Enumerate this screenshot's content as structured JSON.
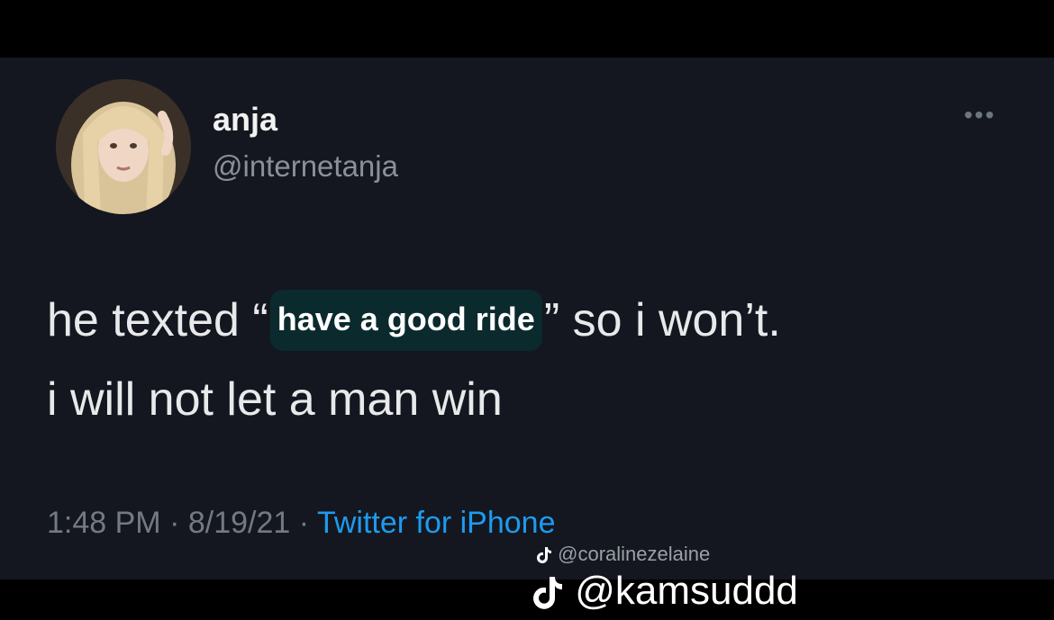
{
  "tweet": {
    "display_name": "anja",
    "handle": "@internetanja",
    "more_icon": "more-horizontal-icon",
    "text": {
      "prefix": "he texted",
      "open_quote": "“",
      "highlight": "have a good ride",
      "close_quote": "”",
      "suffix": "so i won’t.",
      "line2": "i will not let a man win"
    },
    "meta": {
      "time": "1:48 PM",
      "separator": "·",
      "date": "8/19/21",
      "source": "Twitter for iPhone"
    },
    "colors": {
      "background": "#14171f",
      "link": "#1d9bf0",
      "text": "#e7e9ea",
      "secondary": "#8a9099"
    }
  },
  "watermarks": {
    "small": "@coralinezelaine",
    "large": "@kamsuddd",
    "icon": "tiktok-icon"
  }
}
